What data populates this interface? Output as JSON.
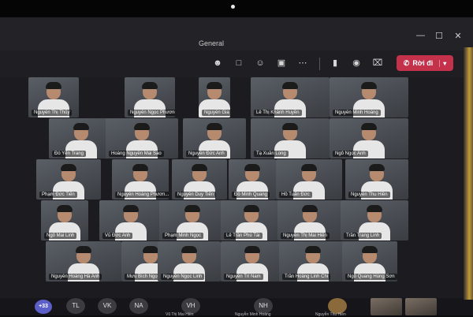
{
  "window": {
    "title": "General",
    "controls": [
      "minimize-icon",
      "maximize-icon",
      "close-icon"
    ]
  },
  "toolbar": {
    "buttons": [
      {
        "name": "people-icon",
        "glyph": "👥"
      },
      {
        "name": "chat-icon",
        "glyph": "💬"
      },
      {
        "name": "reactions-icon",
        "glyph": "☺"
      },
      {
        "name": "rooms-icon",
        "glyph": "⧉"
      },
      {
        "name": "more-icon",
        "glyph": "•••"
      },
      {
        "name": "camera-icon",
        "glyph": "▭"
      },
      {
        "name": "mic-icon",
        "glyph": "🎙"
      },
      {
        "name": "share-icon",
        "glyph": "⊠"
      }
    ],
    "leave_label": "Rời đi",
    "leave_color": "#c4314b"
  },
  "participants": [
    {
      "name": "Nguyễn Thị Thủy"
    },
    {
      "name": "Nguyễn Ngọc Phương Chi"
    },
    {
      "name": "Nguyễn Gia Huy"
    },
    {
      "name": "Lê Thị Khánh Huyền"
    },
    {
      "name": "Nguyễn Minh Hoàng"
    },
    {
      "name": "Đỗ Yến Trang"
    },
    {
      "name": "Hoàng Nguyễn Mai Sao"
    },
    {
      "name": "Nguyễn Đức Anh"
    },
    {
      "name": "Tạ Xuân Long"
    },
    {
      "name": "Ngô Ngọc Anh"
    },
    {
      "name": "Phạm Đức Tiến"
    },
    {
      "name": "Nguyễn Hoàng Phươn..."
    },
    {
      "name": "Nguyễn Duy Tiến"
    },
    {
      "name": "Đỗ Minh Quang"
    },
    {
      "name": "Hồ Tuấn Đức"
    },
    {
      "name": "Nguyễn Thu Hiền"
    },
    {
      "name": "Ngô Mai Linh"
    },
    {
      "name": "Vũ Đức Anh"
    },
    {
      "name": "Phạm Minh Ngọc"
    },
    {
      "name": "Lê Trần Phú Tài"
    },
    {
      "name": "Nguyễn Thị Mai Hiền"
    },
    {
      "name": "Trần Trang Linh"
    },
    {
      "name": "Nguyễn Hoàng Hà Anh"
    },
    {
      "name": "Mưu Bích Ngọc"
    },
    {
      "name": "Nguyễn Ngọc Linh"
    },
    {
      "name": "Nguyễn Trí Nam"
    },
    {
      "name": "Trần Hoàng Linh Chi"
    },
    {
      "name": "Ngô Quang Hùng Sơn"
    }
  ],
  "bottom": {
    "overflow_count": "+33",
    "avatars": [
      {
        "initials": "TL"
      },
      {
        "initials": "VK"
      },
      {
        "initials": "NA"
      },
      {
        "initials": "VH",
        "label": "Vũ Thị Mai Hiền"
      },
      {
        "initials": "NH",
        "label": "Nguyễn Minh Hoàng"
      },
      {
        "initials": "",
        "label": "Nguyễn Thu Hiền"
      }
    ]
  },
  "colors": {
    "accent": "#5b5fc7",
    "leave": "#c4314b",
    "background": "#1c1c20"
  }
}
